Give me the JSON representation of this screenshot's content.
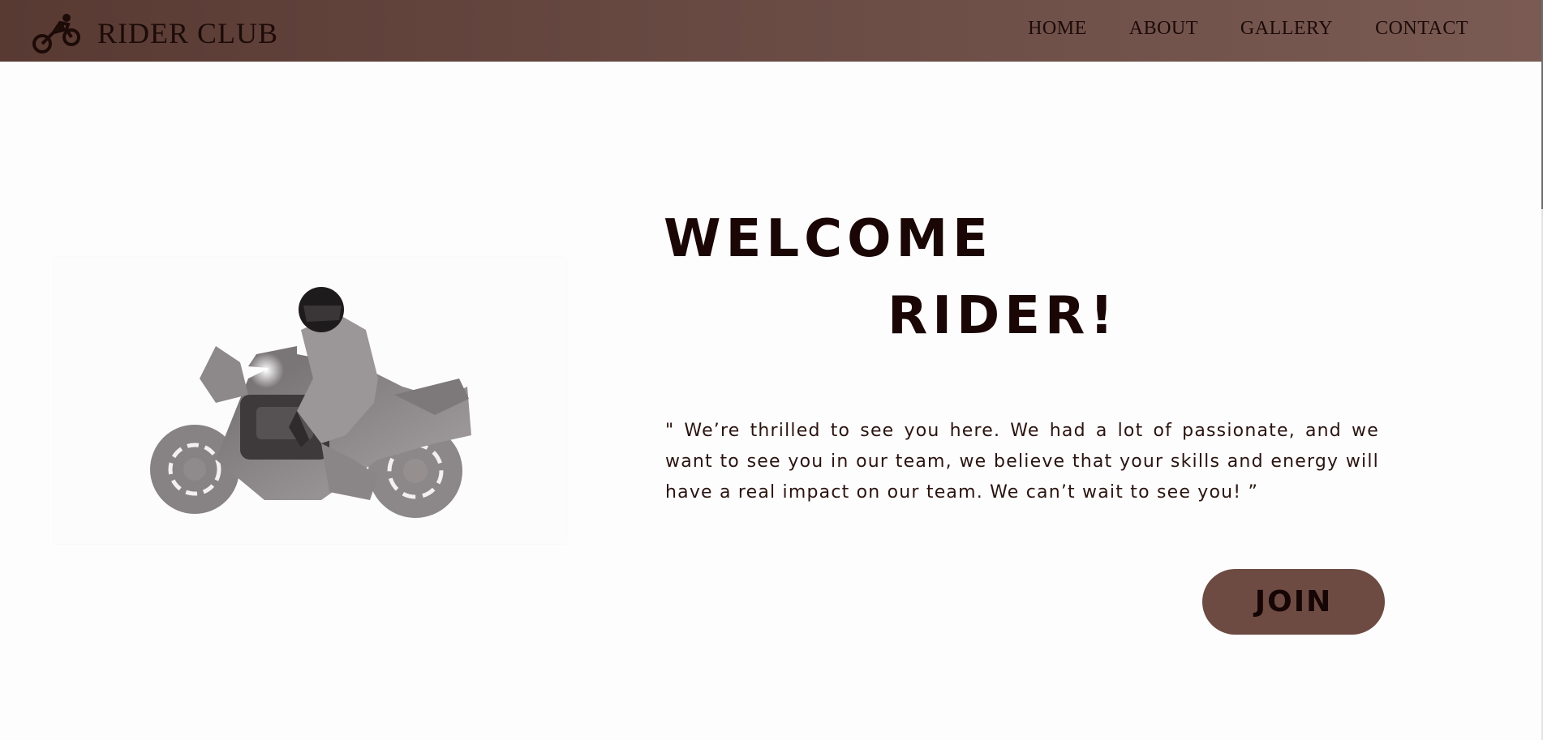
{
  "navbar": {
    "brand_icon": "motorcycle-icon",
    "brand_name": "RIDER CLUB",
    "links": [
      {
        "label": "HOME"
      },
      {
        "label": "ABOUT"
      },
      {
        "label": "GALLERY"
      },
      {
        "label": "CONTACT"
      }
    ]
  },
  "hero": {
    "image": "motorcycle-rider-image",
    "title_line1": "WELCOME",
    "title_line2": "RIDER!",
    "quote": "\" We’re thrilled to see you here. We had a lot of passionate, and we want to see you in our team, we believe that your skills and energy will have a real impact on our team. We can’t wait to see you! ”",
    "join_label": "JOIN"
  },
  "colors": {
    "navbar_start": "#583a33",
    "navbar_end": "#7a5b53",
    "button": "#6d4b43",
    "text_dark": "#1b0606",
    "background": "#fefdfd"
  }
}
